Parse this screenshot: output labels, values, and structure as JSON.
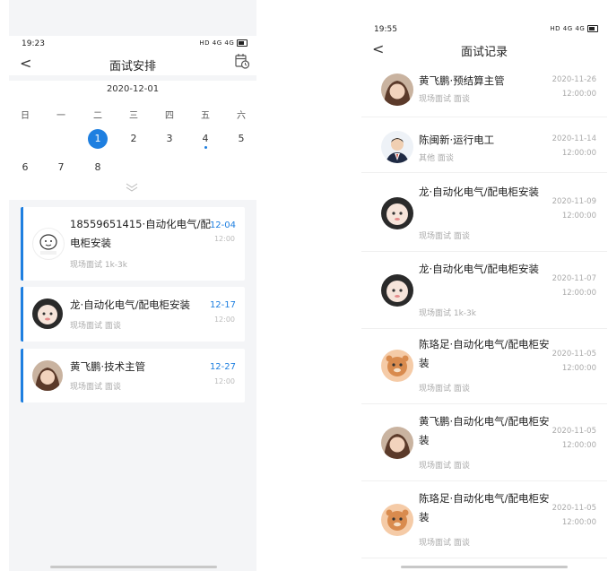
{
  "left": {
    "status": {
      "time": "19:23",
      "signal_text": "HD 4G 4G"
    },
    "nav": {
      "back_label": "<",
      "title": "面试安排"
    },
    "calendar": {
      "month": "2020-12-01",
      "weekdays": [
        "日",
        "一",
        "二",
        "三",
        "四",
        "五",
        "六"
      ],
      "week1": [
        "1",
        "2",
        "3",
        "4",
        "5"
      ],
      "week2": [
        "6",
        "7",
        "8"
      ],
      "selected_day": "1",
      "dot_day": "4"
    },
    "cards": [
      {
        "name": "18559651415·自动化电气/配电柜安装",
        "meta": "现场面试  1k-3k",
        "date": "12-04",
        "time": "12:00"
      },
      {
        "name": "龙·自动化电气/配电柜安装",
        "meta": "现场面试  面谈",
        "date": "12-17",
        "time": "12:00"
      },
      {
        "name": "黄飞鹏·技术主管",
        "meta": "现场面试  面谈",
        "date": "12-27",
        "time": "12:00"
      }
    ]
  },
  "right": {
    "status": {
      "time": "19:55",
      "signal_text": "HD 4G 4G"
    },
    "nav": {
      "back_label": "<",
      "title": "面试记录"
    },
    "records": [
      {
        "name": "黄飞鹏·预结算主管",
        "meta": "现场面试  面谈",
        "date": "2020-11-26",
        "time": "12:00:00",
        "avatar": "girl"
      },
      {
        "name": "陈闽新·运行电工",
        "meta": "其他  面谈",
        "date": "2020-11-14",
        "time": "12:00:00",
        "avatar": "suit"
      },
      {
        "name": "龙·自动化电气/配电柜安装",
        "meta": "现场面试  面谈",
        "date": "2020-11-09",
        "time": "12:00:00",
        "avatar": "baby"
      },
      {
        "name": "龙·自动化电气/配电柜安装",
        "meta": "现场面试  1k-3k",
        "date": "2020-11-07",
        "time": "12:00:00",
        "avatar": "baby"
      },
      {
        "name": "陈珞足·自动化电气/配电柜安装",
        "meta": "现场面试  面谈",
        "date": "2020-11-05",
        "time": "12:00:00",
        "avatar": "cartoon"
      },
      {
        "name": "黄飞鹏·自动化电气/配电柜安装",
        "meta": "现场面试  面谈",
        "date": "2020-11-05",
        "time": "12:00:00",
        "avatar": "girl"
      },
      {
        "name": "陈珞足·自动化电气/配电柜安装",
        "meta": "现场面试  面谈",
        "date": "2020-11-05",
        "time": "12:00:00",
        "avatar": "cartoon"
      }
    ]
  },
  "colors": {
    "accent": "#1e7fe0",
    "muted": "#aaaaaa",
    "background": "#f4f5f7"
  },
  "icons": [
    "back-icon",
    "calendar-clock-icon",
    "chevron-down-icon",
    "wifi-icon",
    "battery-icon"
  ]
}
